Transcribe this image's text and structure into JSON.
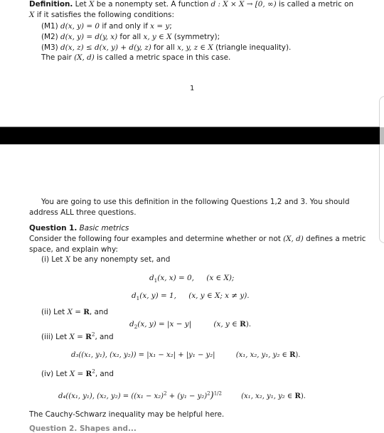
{
  "definition": {
    "heading": "Definition.",
    "line1_a": "Let ",
    "line1_X": "X",
    "line1_b": " be a nonempty set. A function ",
    "line1_func": "d : X × X → [0, ∞)",
    "line1_c": " is called a metric on",
    "line2_X": "X",
    "line2_b": " if it satisfies the following conditions:",
    "conditions": [
      {
        "label": "(M1)",
        "math1": "d(x, y) = 0",
        "text": " if and only if ",
        "math2": "x = y",
        "tail": ";"
      },
      {
        "label": "(M2)",
        "math1": "d(x, y) = d(y, x)",
        "text": " for all ",
        "math2": "x, y ∈ X",
        "tail": " (symmetry);"
      },
      {
        "label": "(M3)",
        "math1": "d(x, z) ≤ d(x, y) + d(y, z)",
        "text": " for all ",
        "math2": "x, y, z ∈ X",
        "tail": " (triangle inequality)."
      }
    ],
    "closing_a": "The pair ",
    "closing_math": "(X, d)",
    "closing_b": " is called a metric space in this case."
  },
  "page_number": "1",
  "intro": {
    "line1": "You are going to use this definition in the following Questions 1,2 and 3.  You should",
    "line2": "address ALL three questions."
  },
  "question1": {
    "heading": "Question 1.",
    "subtitle": "Basic metrics",
    "prompt_a": "Consider the following four examples and determine whether or not ",
    "prompt_math": "(X, d)",
    "prompt_b": " defines a metric",
    "prompt_line2": "space, and explain why:",
    "items": [
      {
        "label": "(i) Let ",
        "math": "X",
        "rest": " be any nonempty set, and",
        "eq1_lhs": "d",
        "eq1_sub": "1",
        "eq1_body": "(x, x) = 0,",
        "eq1_cond": "(x ∈ X);",
        "eq2_lhs": "d",
        "eq2_sub": "1",
        "eq2_body": "(x, y) = 1,",
        "eq2_cond": "(x, y ∈ X; x ≠ y)."
      },
      {
        "label": "(ii) Let ",
        "math": "X = ",
        "set": "R",
        "rest": ", and",
        "eq_lhs": "d",
        "eq_sub": "2",
        "eq_body": "(x, y) = |x − y|",
        "eq_cond_a": "(x, y ∈ ",
        "eq_cond_set": "R",
        "eq_cond_b": ")."
      },
      {
        "label": "(iii) Let ",
        "math": "X = ",
        "set": "R",
        "sup": "2",
        "rest": ", and",
        "eq_text": "d₃((x₁, y₁), (x₂, y₂)) = |x₁ − x₂| + |y₁ − y₂|",
        "eq_cond_a": "(x₁, x₂, y₁, y₂ ∈ ",
        "eq_cond_set": "R",
        "eq_cond_b": ")."
      },
      {
        "label": "(iv) Let ",
        "math": "X = ",
        "set": "R",
        "sup": "2",
        "rest": ", and",
        "eq_text_a": "d₄((x₁, y₁), (x₂, y₂) = ((x₁ − x₂)",
        "eq_sq1": "2",
        "eq_text_b": " + (y₁ − y₂)",
        "eq_sq2": "2",
        "eq_text_c": ")",
        "eq_exp": "1/2",
        "eq_cond_a": "(x₁, x₂, y₁, y₂ ∈ ",
        "eq_cond_set": "R",
        "eq_cond_b": ")."
      }
    ],
    "hint": "The Cauchy-Schwarz inequality may be helpful here.",
    "next_heading_partial": "Question 2. Shapes and..."
  }
}
